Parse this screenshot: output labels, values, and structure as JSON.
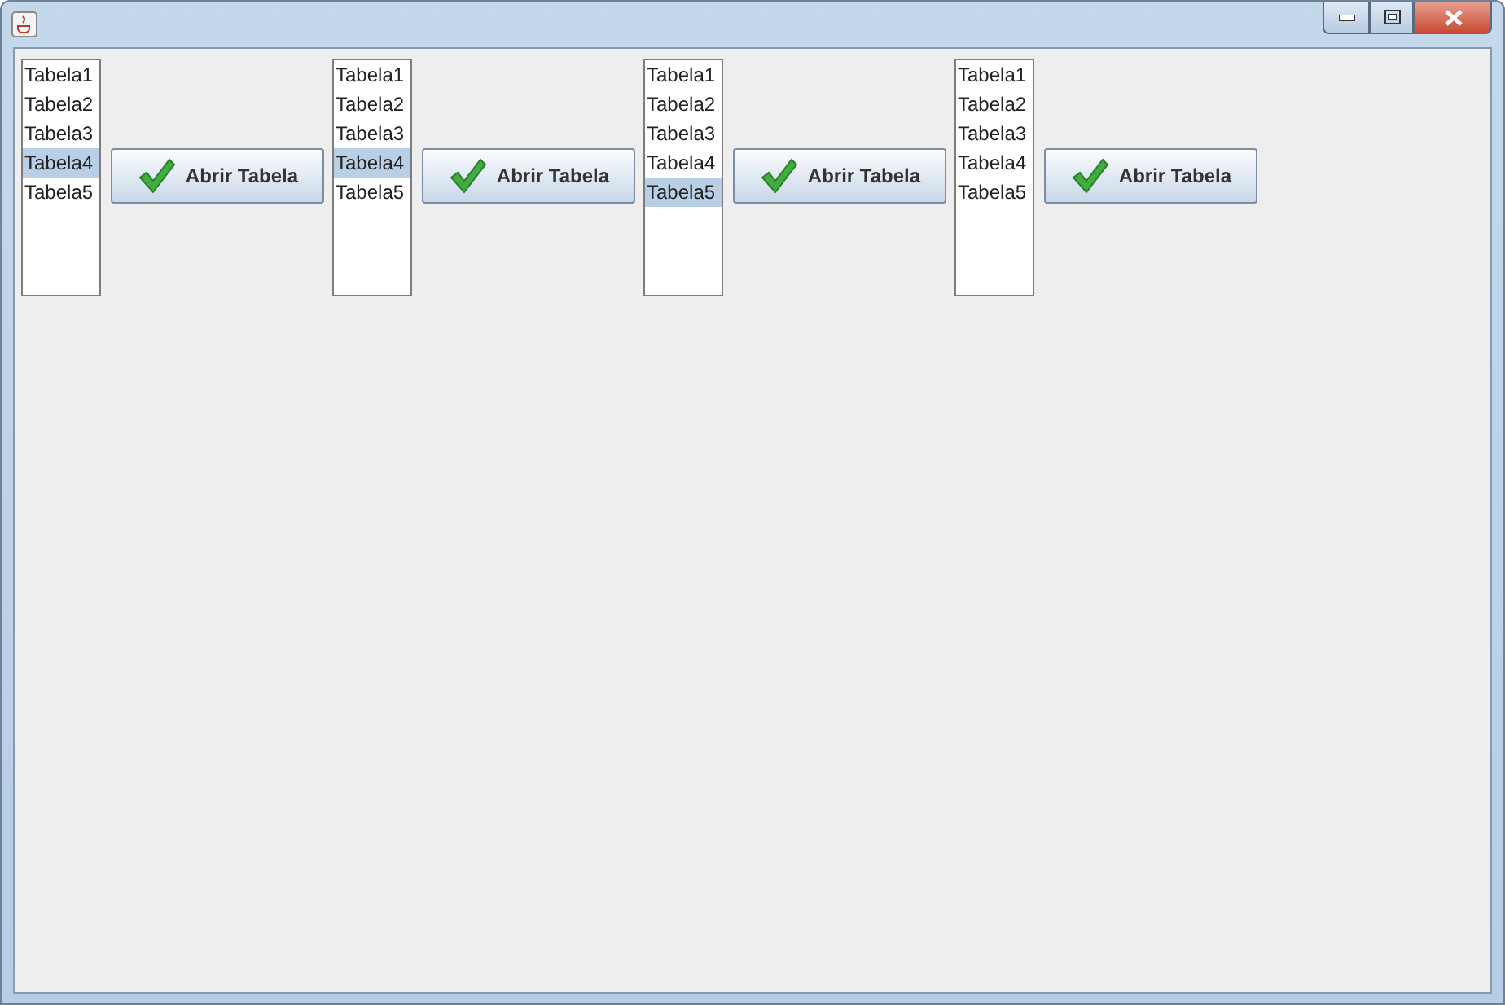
{
  "groups": [
    {
      "list": [
        {
          "label": "Tabela1",
          "selected": false
        },
        {
          "label": "Tabela2",
          "selected": false
        },
        {
          "label": "Tabela3",
          "selected": false
        },
        {
          "label": "Tabela4",
          "selected": true
        },
        {
          "label": "Tabela5",
          "selected": false
        }
      ],
      "button": "Abrir Tabela"
    },
    {
      "list": [
        {
          "label": "Tabela1",
          "selected": false
        },
        {
          "label": "Tabela2",
          "selected": false
        },
        {
          "label": "Tabela3",
          "selected": false
        },
        {
          "label": "Tabela4",
          "selected": true
        },
        {
          "label": "Tabela5",
          "selected": false
        }
      ],
      "button": "Abrir Tabela"
    },
    {
      "list": [
        {
          "label": "Tabela1",
          "selected": false
        },
        {
          "label": "Tabela2",
          "selected": false
        },
        {
          "label": "Tabela3",
          "selected": false
        },
        {
          "label": "Tabela4",
          "selected": false
        },
        {
          "label": "Tabela5",
          "selected": true
        }
      ],
      "button": "Abrir Tabela"
    },
    {
      "list": [
        {
          "label": "Tabela1",
          "selected": false
        },
        {
          "label": "Tabela2",
          "selected": false
        },
        {
          "label": "Tabela3",
          "selected": false
        },
        {
          "label": "Tabela4",
          "selected": false
        },
        {
          "label": "Tabela5",
          "selected": false
        }
      ],
      "button": "Abrir Tabela"
    }
  ]
}
